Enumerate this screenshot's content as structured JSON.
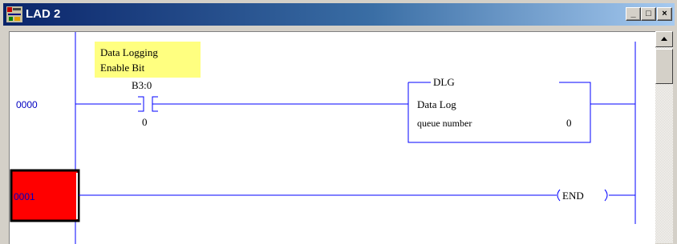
{
  "window": {
    "title": "LAD 2"
  },
  "caption_buttons": {
    "minimize": "_",
    "maximize": "□",
    "close": "×"
  },
  "rungs": [
    {
      "number": "0000",
      "comment_line1": "Data Logging",
      "comment_line2": "Enable Bit",
      "contact_address": "B3:0",
      "contact_bit": "0",
      "instruction": {
        "mnemonic": "DLG",
        "title": "Data Log",
        "param_label": "queue number",
        "param_value": "0"
      }
    },
    {
      "number": "0001",
      "end_label": "END",
      "selected": true
    }
  ],
  "colors": {
    "selection": "#ff0000",
    "rung_number": "#0000c0",
    "comment_bg": "#ffff80",
    "titlebar_start": "#0a246a",
    "titlebar_end": "#a6caf0"
  }
}
